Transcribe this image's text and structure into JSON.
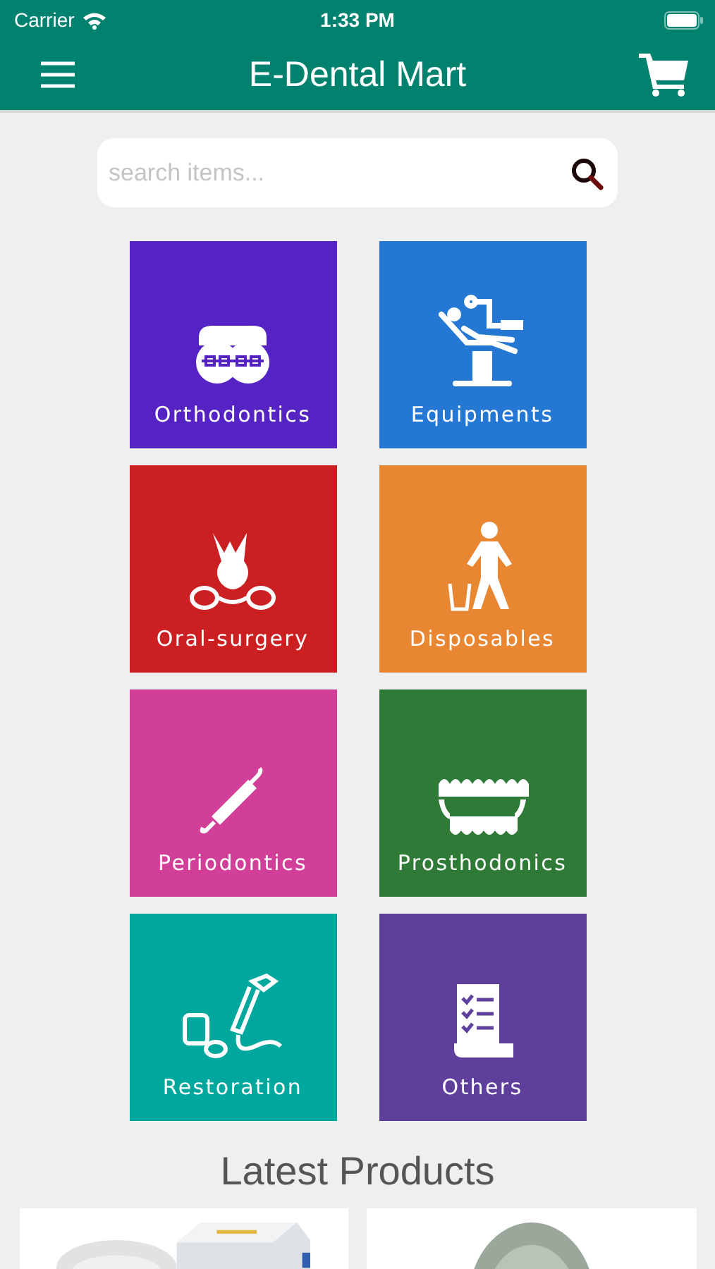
{
  "status_bar": {
    "carrier": "Carrier",
    "time": "1:33 PM"
  },
  "header": {
    "title": "E-Dental Mart"
  },
  "search": {
    "placeholder": "search items..."
  },
  "categories": [
    {
      "label": "Orthodontics",
      "color": "#5523c3"
    },
    {
      "label": "Equipments",
      "color": "#2478d4"
    },
    {
      "label": "Oral-surgery",
      "color": "#cc1f22"
    },
    {
      "label": "Disposables",
      "color": "#e88632"
    },
    {
      "label": "Periodontics",
      "color": "#d13f98"
    },
    {
      "label": "Prosthodonics",
      "color": "#2e7a36"
    },
    {
      "label": "Restoration",
      "color": "#00a79d"
    },
    {
      "label": "Others",
      "color": "#5e3f9b"
    }
  ],
  "latest_products": {
    "title": "Latest Products"
  }
}
